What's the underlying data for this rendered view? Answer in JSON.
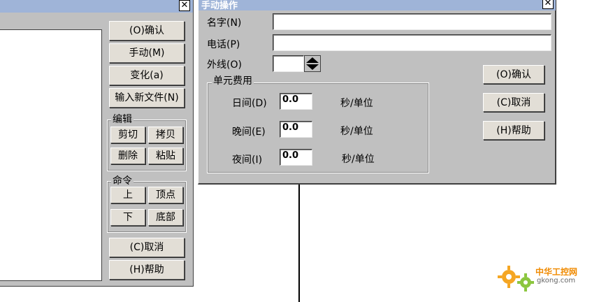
{
  "left_dialog": {
    "buttons": {
      "ok": "(O)确认",
      "manual": "手动(M)",
      "change": "变化(a)",
      "new_file": "输入新文件(N)",
      "cancel": "(C)取消",
      "help": "(H)帮助"
    },
    "edit_group": {
      "label": "编辑",
      "cut": "剪切",
      "copy": "拷贝",
      "delete": "删除",
      "paste": "粘贴"
    },
    "command_group": {
      "label": "命令",
      "up": "上",
      "top": "顶点",
      "down": "下",
      "bottom": "底部"
    }
  },
  "manual_dialog": {
    "title": "手动操作",
    "name_label": "名字(N)",
    "name_value": "",
    "phone_label": "电话(P)",
    "phone_value": "",
    "outline_label": "外线(O)",
    "outline_value": "",
    "rate_group": {
      "label": "单元费用",
      "day_label": "日间(D)",
      "day_value": "0.0",
      "evening_label": "晚间(E)",
      "evening_value": "0.0",
      "night_label": "夜间(I)",
      "night_value": "0.0",
      "unit": "秒/单位"
    },
    "ok": "(O)确认",
    "cancel": "(C)取消",
    "help": "(H)帮助"
  },
  "watermark": {
    "name": "中华工控网",
    "site": "gkong.com"
  }
}
